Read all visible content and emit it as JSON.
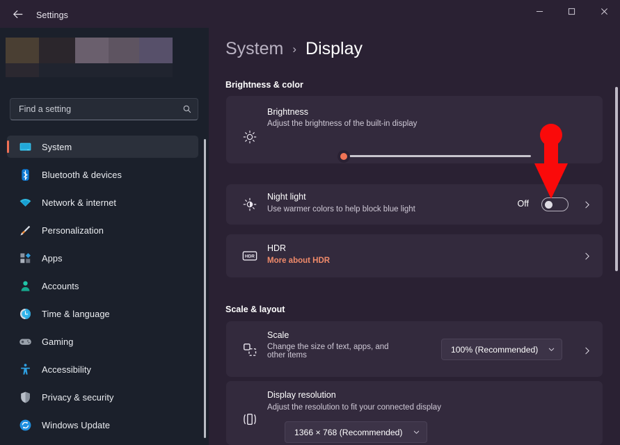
{
  "window": {
    "title": "Settings",
    "back_icon": "back-arrow-icon",
    "minimize_label": "Minimize",
    "maximize_label": "Maximize",
    "close_label": "Close"
  },
  "sidebar": {
    "search": {
      "placeholder": "Find a setting",
      "value": "",
      "icon": "search-icon"
    },
    "items": [
      {
        "label": "System",
        "icon": "monitor-icon",
        "selected": true
      },
      {
        "label": "Bluetooth & devices",
        "icon": "bluetooth-icon",
        "selected": false
      },
      {
        "label": "Network & internet",
        "icon": "wifi-icon",
        "selected": false
      },
      {
        "label": "Personalization",
        "icon": "paintbrush-icon",
        "selected": false
      },
      {
        "label": "Apps",
        "icon": "apps-icon",
        "selected": false
      },
      {
        "label": "Accounts",
        "icon": "person-icon",
        "selected": false
      },
      {
        "label": "Time & language",
        "icon": "clock-icon",
        "selected": false
      },
      {
        "label": "Gaming",
        "icon": "gamepad-icon",
        "selected": false
      },
      {
        "label": "Accessibility",
        "icon": "accessibility-icon",
        "selected": false
      },
      {
        "label": "Privacy & security",
        "icon": "shield-icon",
        "selected": false
      },
      {
        "label": "Windows Update",
        "icon": "update-icon",
        "selected": false
      }
    ]
  },
  "main": {
    "breadcrumb": {
      "parent": "System",
      "separator": "›",
      "current": "Display"
    },
    "sections": [
      {
        "title": "Brightness & color"
      },
      {
        "title": "Scale & layout"
      }
    ],
    "brightness": {
      "title": "Brightness",
      "subtitle": "Adjust the brightness of the built-in display",
      "icon": "brightness-sun-icon",
      "slider_value": 0
    },
    "night_light": {
      "title": "Night light",
      "subtitle": "Use warmer colors to help block blue light",
      "icon": "night-light-icon",
      "state_label": "Off",
      "toggle_on": false,
      "chevron": "chevron-right-icon"
    },
    "hdr": {
      "title": "HDR",
      "link_label": "More about HDR",
      "icon": "hdr-icon",
      "chevron": "chevron-right-icon"
    },
    "scale": {
      "title": "Scale",
      "subtitle": "Change the size of text, apps, and other items",
      "icon": "scale-icon",
      "selected_option": "100% (Recommended)",
      "chevron": "chevron-right-icon",
      "caret": "chevron-down-icon"
    },
    "resolution": {
      "title": "Display resolution",
      "subtitle": "Adjust the resolution to fit your connected display",
      "icon": "resolution-icon",
      "selected_option": "1366 × 768 (Recommended)",
      "caret": "chevron-down-icon"
    }
  },
  "annotation": {
    "arrow": "red-down-arrow",
    "color": "#fa0a0a"
  },
  "colors": {
    "accent": "#f07355",
    "page_background": "#2a2133",
    "sidebar_background": "#1b202b",
    "card_background": "#332a3d",
    "link": "#ef8a6a"
  }
}
